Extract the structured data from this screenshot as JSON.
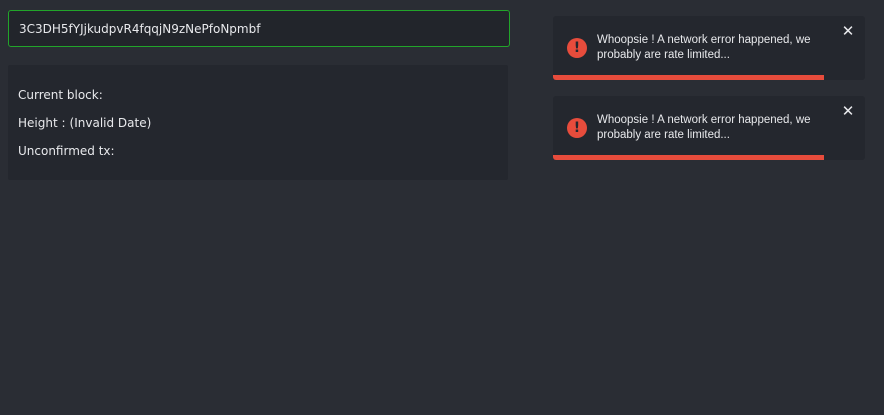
{
  "address": {
    "value": "3C3DH5fYJjkudpvR4fqqjN9zNePfoNpmbf"
  },
  "info": {
    "current_block_label": "Current block:",
    "current_block_value": "",
    "height_label": "Height :",
    "height_value": "(Invalid Date)",
    "unconfirmed_label": "Unconfirmed tx:",
    "unconfirmed_value": ""
  },
  "toasts": [
    {
      "icon": "exclamation-icon",
      "message": "Whoopsie ! A network error happened, we probably are rate limited...",
      "close": "✕"
    },
    {
      "icon": "exclamation-icon",
      "message": "Whoopsie ! A network error happened, we probably are rate limited...",
      "close": "✕"
    }
  ],
  "colors": {
    "background": "#2a2d34",
    "panel": "#24272e",
    "input_border": "#22a52a",
    "error": "#e74c3c",
    "text": "#e8e9ec"
  }
}
